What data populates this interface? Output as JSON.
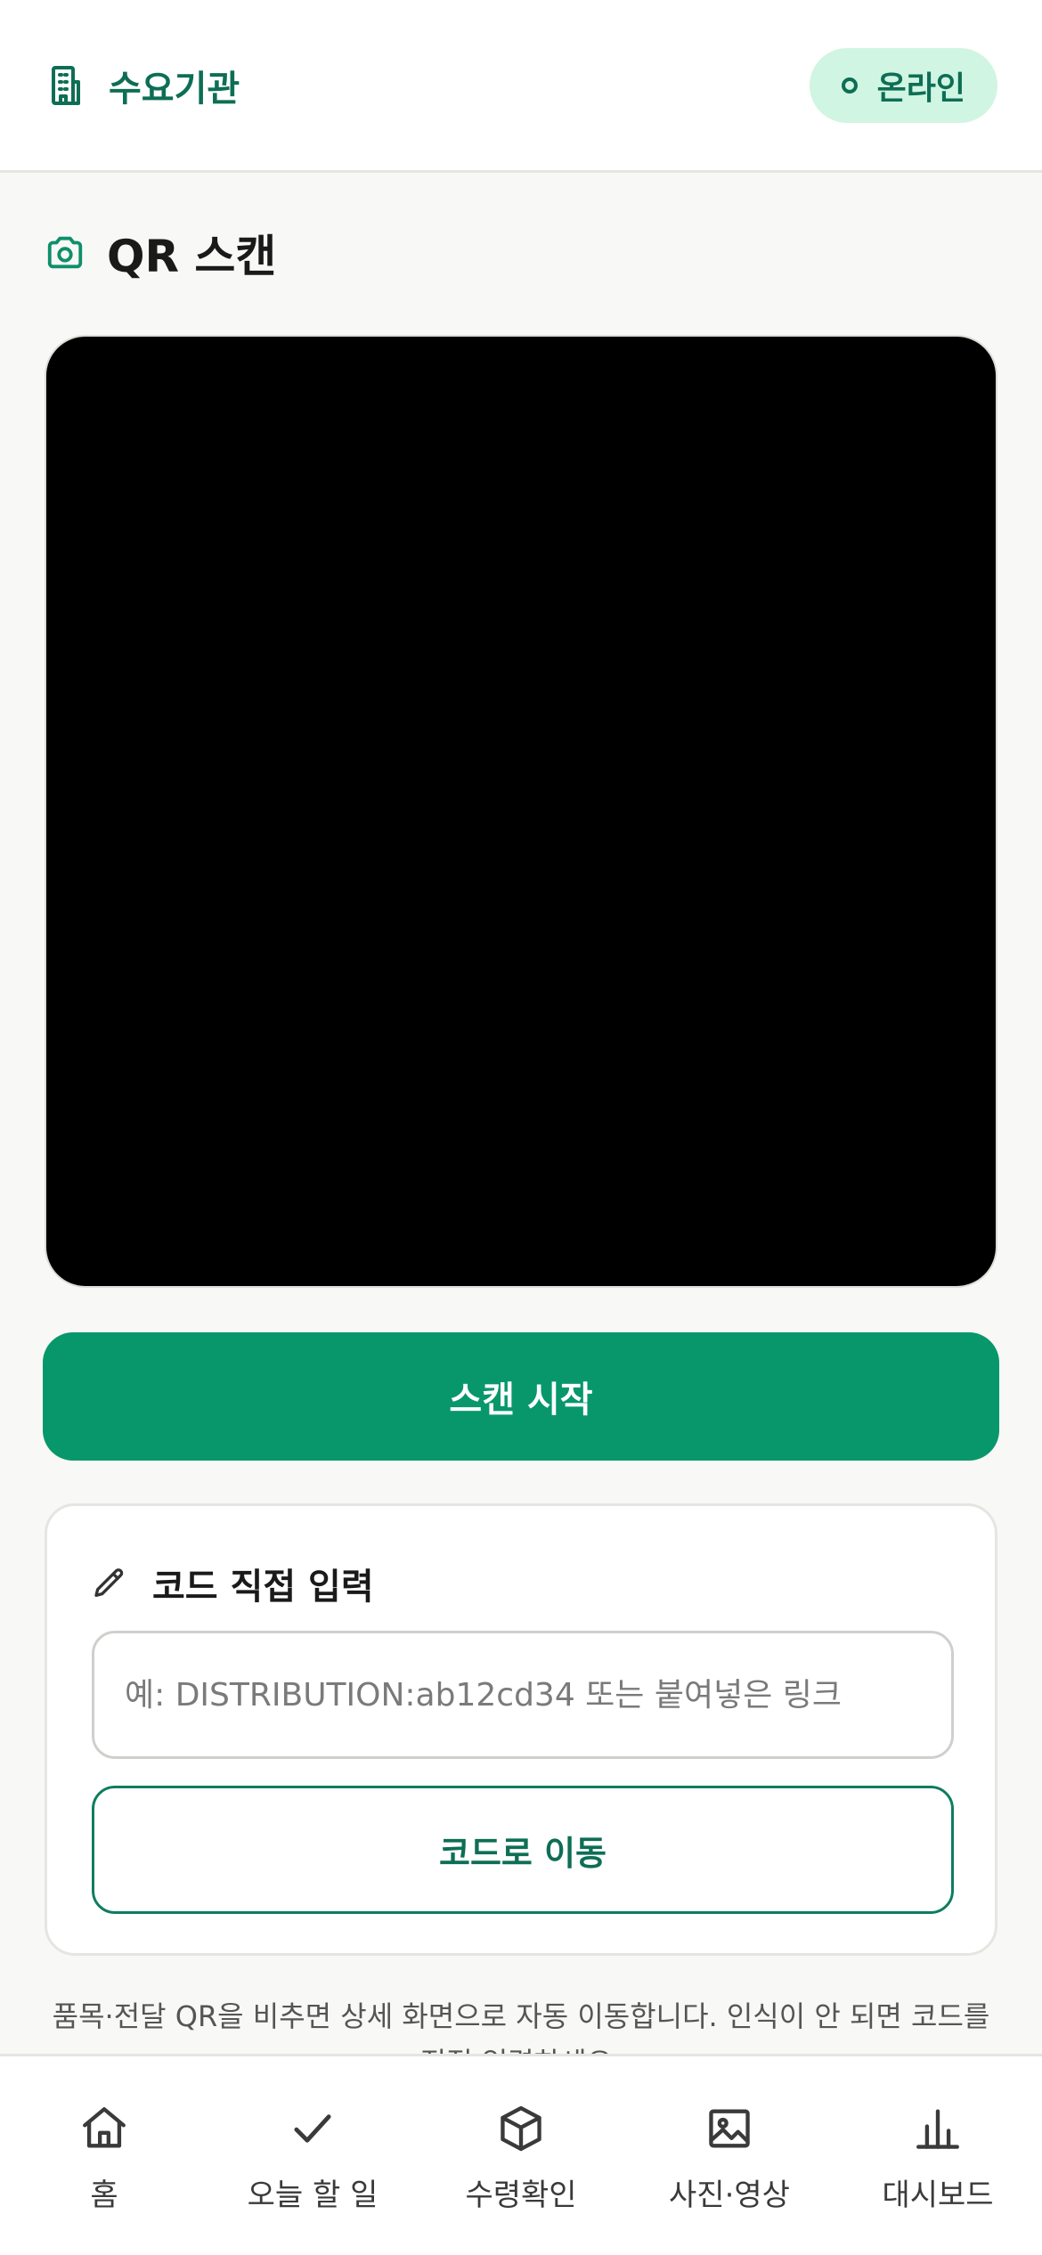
{
  "header": {
    "title": "수요기관",
    "icon": "building-icon",
    "status_label": "온라인",
    "accent_color": "#0e6e55",
    "status_bg": "#d1f5e3"
  },
  "scan_section": {
    "icon": "camera-icon",
    "title": "QR 스캔",
    "start_button": "스캔 시작",
    "button_color": "#07976b"
  },
  "manual_entry": {
    "icon": "pencil-icon",
    "title": "코드 직접 입력",
    "input_value": "",
    "input_placeholder": "예: DISTRIBUTION:ab12cd34 또는 붙여넣은 링크",
    "go_button": "코드로 이동"
  },
  "help_text": "품목·전달 QR을 비추면 상세 화면으로 자동 이동합니다. 인식이 안 되면 코드를 직접 입력하세요.",
  "bottom_nav": {
    "items": [
      {
        "label": "홈",
        "icon": "home-icon"
      },
      {
        "label": "오늘 할 일",
        "icon": "check-icon"
      },
      {
        "label": "수령확인",
        "icon": "box-icon"
      },
      {
        "label": "사진·영상",
        "icon": "image-icon"
      },
      {
        "label": "대시보드",
        "icon": "bar-chart-icon"
      }
    ]
  }
}
